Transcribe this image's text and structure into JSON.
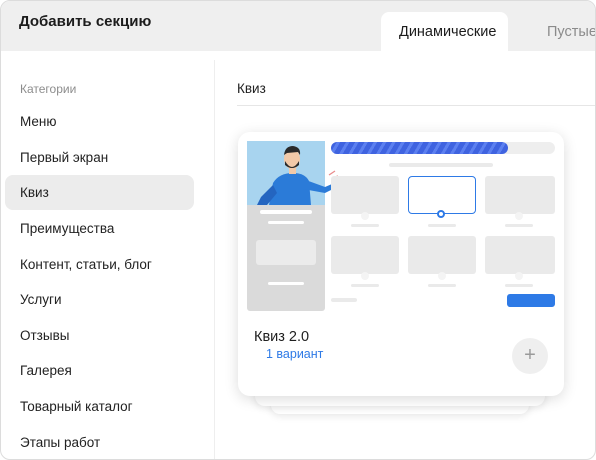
{
  "header": {
    "title": "Добавить секцию",
    "tabs": [
      {
        "label": "Динамические",
        "active": true
      },
      {
        "label": "Пустые",
        "active": false
      }
    ]
  },
  "sidebar": {
    "heading": "Категории",
    "items": [
      {
        "label": "Меню"
      },
      {
        "label": "Первый экран"
      },
      {
        "label": "Квиз",
        "selected": true
      },
      {
        "label": "Преимущества"
      },
      {
        "label": "Контент, статьи, блог"
      },
      {
        "label": "Услуги"
      },
      {
        "label": "Отзывы"
      },
      {
        "label": "Галерея"
      },
      {
        "label": "Товарный каталог"
      },
      {
        "label": "Этапы работ"
      }
    ]
  },
  "main": {
    "section_title": "Квиз",
    "cards": [
      {
        "name": "Квиз 2.0",
        "variants": "1 вариант",
        "add_icon": "+"
      }
    ]
  },
  "colors": {
    "accent": "#2e7ae6",
    "progress_bar": "#3f63e0",
    "illustration_bg": "#a8d4ef",
    "shirt": "#2b7bd8"
  }
}
